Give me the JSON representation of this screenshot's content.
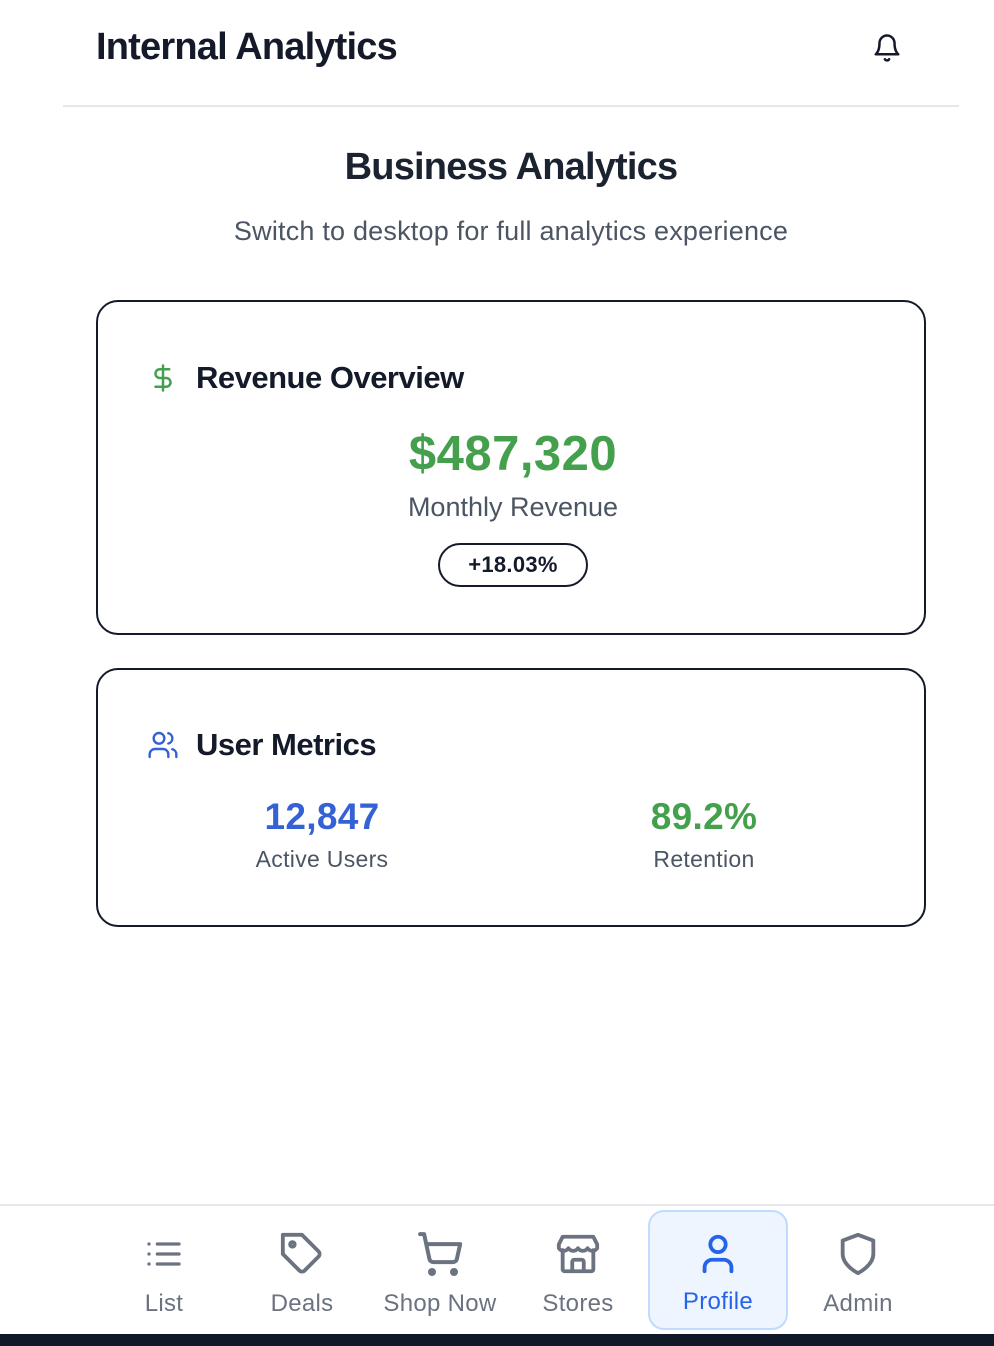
{
  "header": {
    "title": "Internal Analytics",
    "bell_icon": "bell-icon"
  },
  "main": {
    "title": "Business Analytics",
    "subtitle": "Switch to desktop for full analytics experience"
  },
  "revenue_card": {
    "icon": "dollar-sign-icon",
    "title": "Revenue Overview",
    "value": "$487,320",
    "label": "Monthly Revenue",
    "change": "+18.03%",
    "accent": "#45a04d"
  },
  "users_card": {
    "icon": "users-icon",
    "title": "User Metrics",
    "metrics": [
      {
        "value": "12,847",
        "label": "Active Users",
        "color": "#3561d6"
      },
      {
        "value": "89.2%",
        "label": "Retention",
        "color": "#45a04d"
      }
    ]
  },
  "nav": {
    "items": [
      {
        "label": "List",
        "icon": "list-icon"
      },
      {
        "label": "Deals",
        "icon": "tag-icon"
      },
      {
        "label": "Shop Now",
        "icon": "cart-icon"
      },
      {
        "label": "Stores",
        "icon": "store-icon"
      },
      {
        "label": "Profile",
        "icon": "user-icon",
        "active": true
      },
      {
        "label": "Admin",
        "icon": "shield-icon"
      }
    ],
    "active_color": "#2563eb"
  }
}
